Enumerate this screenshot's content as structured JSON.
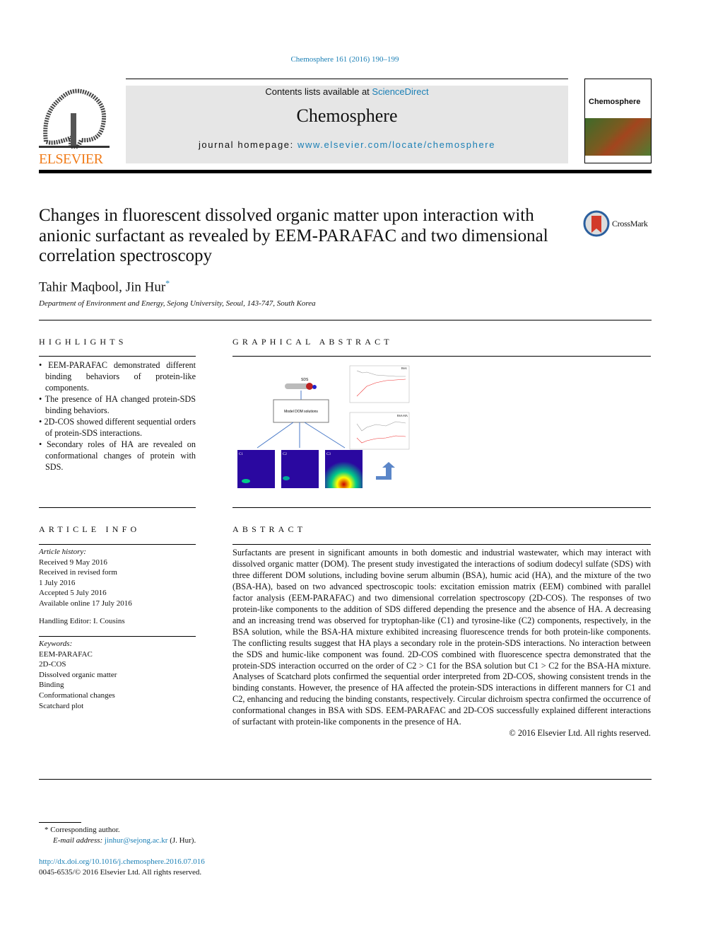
{
  "citation": "Chemosphere 161 (2016) 190–199",
  "header": {
    "contents_prefix": "Contents lists available at ",
    "sciencedirect": "ScienceDirect",
    "journal": "Chemosphere",
    "homepage_prefix": "journal homepage: ",
    "homepage_url": "www.elsevier.com/locate/chemosphere",
    "publisher": "ELSEVIER",
    "cover_title": "Chemosphere"
  },
  "crossmark": "CrossMark",
  "title": "Changes in fluorescent dissolved organic matter upon interaction with anionic surfactant as revealed by EEM-PARAFAC and two dimensional correlation spectroscopy",
  "authors": "Tahir Maqbool, Jin Hur",
  "author_mark": "*",
  "affiliation": "Department of Environment and Energy, Sejong University, Seoul, 143-747, South Korea",
  "highlights": {
    "heading": "HIGHLIGHTS",
    "items": [
      "EEM-PARAFAC demonstrated different binding behaviors of protein-like components.",
      "The presence of HA changed protein-SDS binding behaviors.",
      "2D-COS showed different sequential orders of protein-SDS interactions.",
      "Secondary roles of HA are revealed on conformational changes of protein with SDS."
    ]
  },
  "graphical_abstract": {
    "heading": "GRAPHICAL ABSTRACT",
    "sds": "SDS",
    "box": "Model DOM solutions",
    "plot1": "BSA",
    "plot2": "BSA-HA",
    "maps": [
      "C1",
      "C2",
      "C3"
    ]
  },
  "article_info": {
    "heading": "ARTICLE INFO",
    "history_label": "Article history:",
    "history": [
      "Received 9 May 2016",
      "Received in revised form",
      "1 July 2016",
      "Accepted 5 July 2016",
      "Available online 17 July 2016"
    ],
    "editor": "Handling Editor: I. Cousins",
    "keywords_label": "Keywords:",
    "keywords": [
      "EEM-PARAFAC",
      "2D-COS",
      "Dissolved organic matter",
      "Binding",
      "Conformational changes",
      "Scatchard plot"
    ]
  },
  "abstract": {
    "heading": "ABSTRACT",
    "text": "Surfactants are present in significant amounts in both domestic and industrial wastewater, which may interact with dissolved organic matter (DOM). The present study investigated the interactions of sodium dodecyl sulfate (SDS) with three different DOM solutions, including bovine serum albumin (BSA), humic acid (HA), and the mixture of the two (BSA-HA), based on two advanced spectroscopic tools: excitation emission matrix (EEM) combined with parallel factor analysis (EEM-PARAFAC) and two dimensional correlation spectroscopy (2D-COS). The responses of two protein-like components to the addition of SDS differed depending the presence and the absence of HA. A decreasing and an increasing trend was observed for tryptophan-like (C1) and tyrosine-like (C2) components, respectively, in the BSA solution, while the BSA-HA mixture exhibited increasing fluorescence trends for both protein-like components. The conflicting results suggest that HA plays a secondary role in the protein-SDS interactions. No interaction between the SDS and humic-like component was found. 2D-COS combined with fluorescence spectra demonstrated that the protein-SDS interaction occurred on the order of C2 > C1 for the BSA solution but C1 > C2 for the BSA-HA mixture. Analyses of Scatchard plots confirmed the sequential order interpreted from 2D-COS, showing consistent trends in the binding constants. However, the presence of HA affected the protein-SDS interactions in different manners for C1 and C2, enhancing and reducing the binding constants, respectively. Circular dichroism spectra confirmed the occurrence of conformational changes in BSA with SDS. EEM-PARAFAC and 2D-COS successfully explained different interactions of surfactant with protein-like components in the presence of HA.",
    "copyright": "© 2016 Elsevier Ltd. All rights reserved."
  },
  "footnote": {
    "mark": "*",
    "corresponding": "Corresponding author.",
    "email_label": "E-mail address: ",
    "email": "jinhur@sejong.ac.kr",
    "email_suffix": " (J. Hur)."
  },
  "doi": "http://dx.doi.org/10.1016/j.chemosphere.2016.07.016",
  "issn": "0045-6535/© 2016 Elsevier Ltd. All rights reserved.",
  "colors": {
    "link": "#1a7fb5",
    "elsevier": "#f07c1a",
    "header_bg": "#e6e6e6"
  }
}
